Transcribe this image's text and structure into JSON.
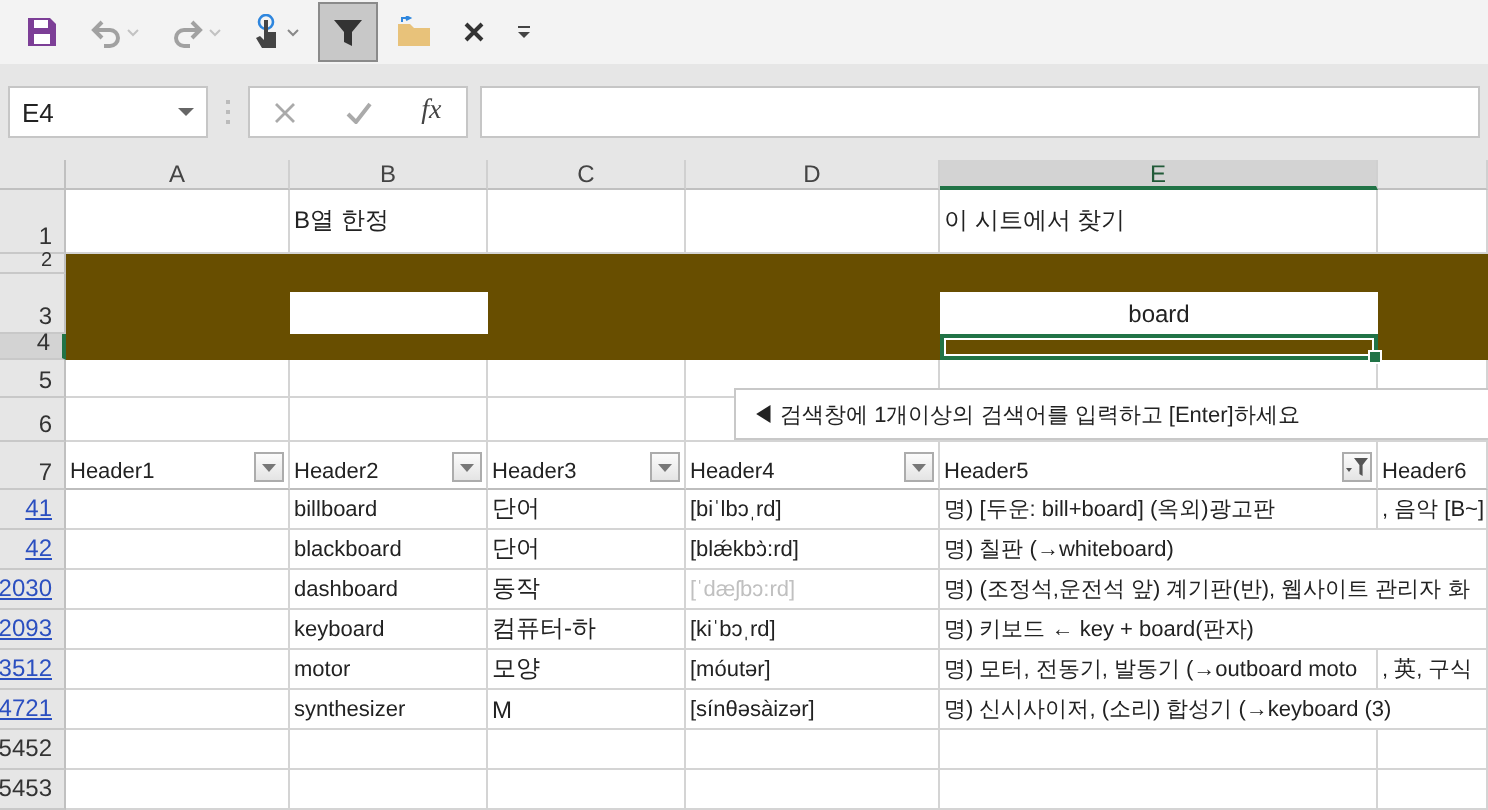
{
  "toolbar": {
    "buttons": [
      {
        "kind": "save",
        "disabled": false,
        "selected": false,
        "menu": false
      },
      {
        "kind": "undo",
        "disabled": true,
        "selected": false,
        "menu": true
      },
      {
        "kind": "redo",
        "disabled": true,
        "selected": false,
        "menu": true
      },
      {
        "kind": "touch",
        "disabled": false,
        "selected": false,
        "menu": true
      },
      {
        "kind": "filter",
        "disabled": false,
        "selected": true,
        "menu": false
      },
      {
        "kind": "folder",
        "disabled": false,
        "selected": false,
        "menu": false
      },
      {
        "kind": "close",
        "disabled": false,
        "selected": false,
        "menu": false
      },
      {
        "kind": "customize",
        "disabled": false,
        "selected": false,
        "menu": false
      }
    ]
  },
  "formula_bar": {
    "name_box": "E4",
    "function_label": "fx"
  },
  "sheet": {
    "columns": [
      {
        "label": "A",
        "selected": false
      },
      {
        "label": "B",
        "selected": false
      },
      {
        "label": "C",
        "selected": false
      },
      {
        "label": "D",
        "selected": false
      },
      {
        "label": "E",
        "selected": true
      }
    ],
    "top_row_numbers": [
      {
        "label": "1",
        "selected": false
      },
      {
        "label": "2",
        "selected": false
      },
      {
        "label": "3",
        "selected": false
      },
      {
        "label": "4",
        "selected": true
      },
      {
        "label": "5",
        "selected": false
      },
      {
        "label": "6",
        "selected": false
      },
      {
        "label": "7",
        "selected": false
      }
    ],
    "column_b_caption": "B열 한정",
    "column_e_caption": "이 시트에서 찾기",
    "search_value": "board",
    "note": "◀ 검색창에 1개이상의  검색어를 입력하고 [Enter]하세요",
    "headers": [
      {
        "label": "Header1",
        "filter_active": false
      },
      {
        "label": "Header2",
        "filter_active": false
      },
      {
        "label": "Header3",
        "filter_active": false
      },
      {
        "label": "Header4",
        "filter_active": false
      },
      {
        "label": "Header5",
        "filter_active": true
      }
    ],
    "last_header": "Header6",
    "rows": [
      {
        "number": "41",
        "filtered": true,
        "cells": [
          {
            "text": ""
          },
          {
            "text": "billboard",
            "faded": false
          },
          {
            "text": "단어",
            "faded": false
          },
          {
            "text": "[biˈlbɔˌrd]",
            "faded": false
          },
          {
            "text": "명) [두운: bill+board] (옥외)광고판",
            "faded": false
          },
          {
            "text": ", 음악 [B~]",
            "faded": false
          }
        ]
      },
      {
        "number": "42",
        "filtered": true,
        "cells": [
          {
            "text": ""
          },
          {
            "text": "blackboard",
            "faded": false
          },
          {
            "text": "단어",
            "faded": false
          },
          {
            "text": "[blǽkbɔ̀:rd]",
            "faded": false
          },
          {
            "text": "명) 칠판 (→whiteboard)",
            "faded": false
          }
        ]
      },
      {
        "number": "2030",
        "filtered": true,
        "cells": [
          {
            "text": ""
          },
          {
            "text": "dashboard",
            "faded": false
          },
          {
            "text": "동작",
            "faded": false
          },
          {
            "text": "[ˈdæʃbɔ:rd]",
            "faded": true
          },
          {
            "text": "명) (조정석,운전석 앞) 계기판(반), 웹사이트 관리자 화",
            "faded": false
          }
        ]
      },
      {
        "number": "2093",
        "filtered": true,
        "cells": [
          {
            "text": ""
          },
          {
            "text": "keyboard",
            "faded": false
          },
          {
            "text": "컴퓨터-하",
            "faded": false
          },
          {
            "text": "[kiˈbɔˌrd]",
            "faded": false
          },
          {
            "text": "명) 키보드 ← key + board(판자)",
            "faded": false
          }
        ]
      },
      {
        "number": "3512",
        "filtered": true,
        "cells": [
          {
            "text": ""
          },
          {
            "text": "motor",
            "faded": false
          },
          {
            "text": "모양",
            "faded": false
          },
          {
            "text": "[móutər]",
            "faded": false
          },
          {
            "text": "명) 모터, 전동기, 발동기 (→outboard moto",
            "faded": false
          },
          {
            "text": ", 英, 구식",
            "faded": false
          }
        ]
      },
      {
        "number": "4721",
        "filtered": true,
        "cells": [
          {
            "text": ""
          },
          {
            "text": "synthesizer",
            "faded": false
          },
          {
            "text": "M",
            "faded": false
          },
          {
            "text": "[sínθəsàizər]",
            "faded": false
          },
          {
            "text": "명) 신시사이저, (소리) 합성기 (→keyboard (3)",
            "faded": false
          }
        ]
      },
      {
        "number": "5452",
        "filtered": false,
        "cells": []
      },
      {
        "number": "5453",
        "filtered": false,
        "cells": []
      }
    ]
  }
}
